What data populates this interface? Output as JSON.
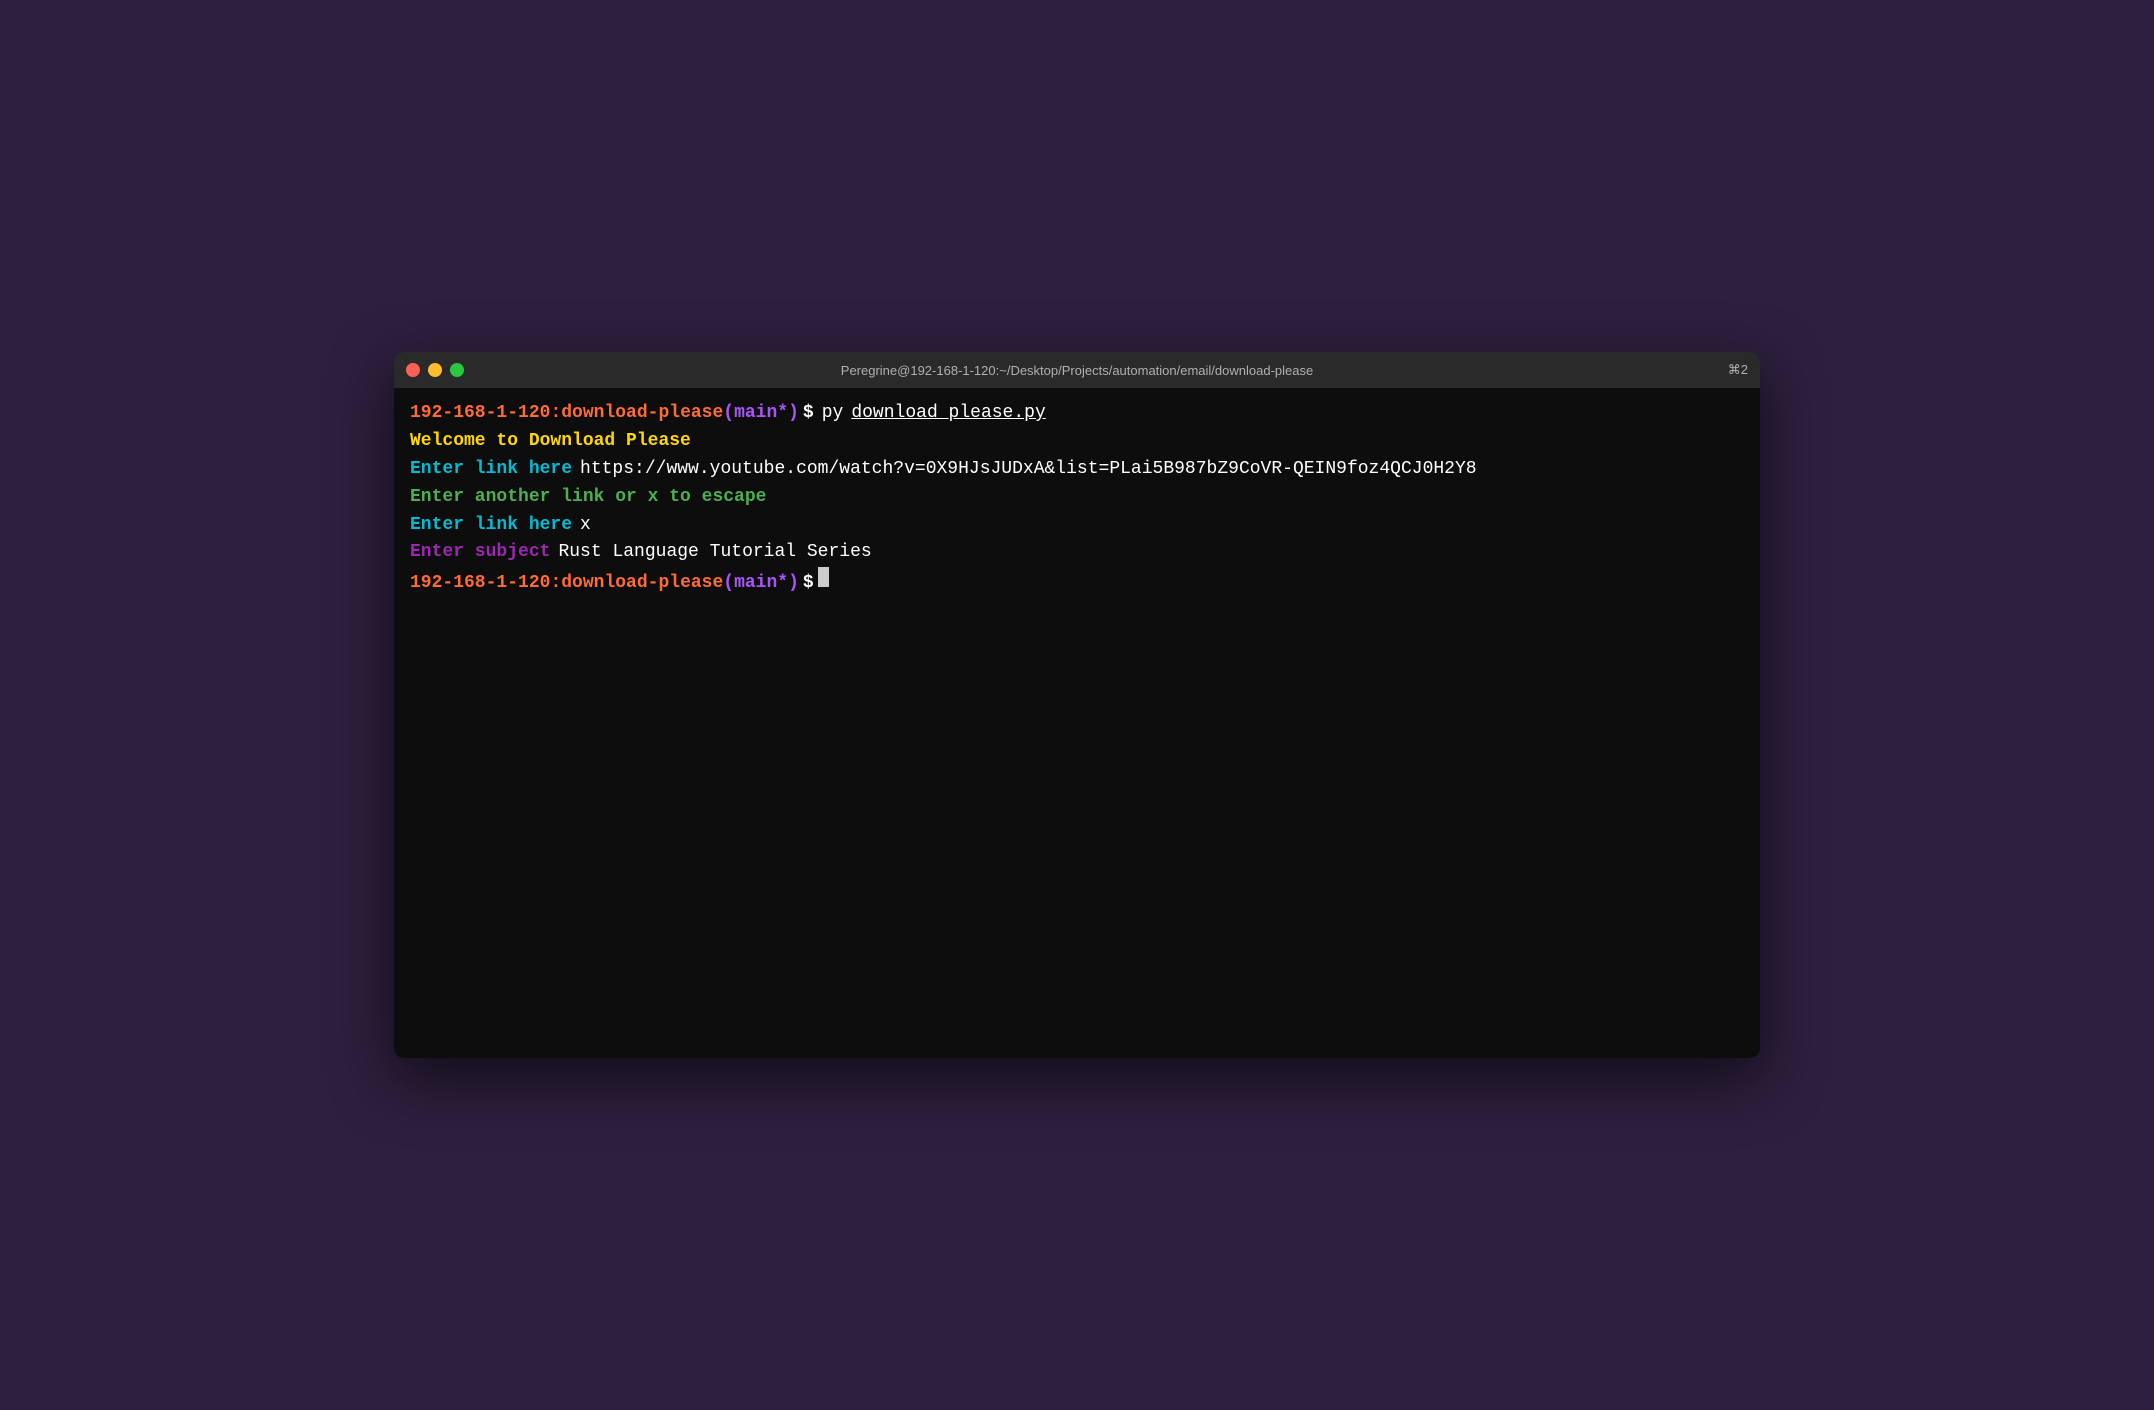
{
  "titleBar": {
    "title": "Peregrine@192-168-1-120:~/Desktop/Projects/automation/email/download-please",
    "shortcut": "⌘2"
  },
  "trafficLights": {
    "close": "close",
    "minimize": "minimize",
    "maximize": "maximize"
  },
  "lines": {
    "line1_prompt_host": "192-168-1-120",
    "line1_prompt_sep": ":",
    "line1_prompt_dir": "download-please",
    "line1_prompt_branch": " (main*)",
    "line1_prompt_dollar": " $",
    "line1_cmd": " py",
    "line1_file": " download_please.py",
    "line2_welcome": "Welcome to Download Please",
    "line3_label": "Enter link here",
    "line3_value": " https://www.youtube.com/watch?v=0X9HJsJUDxA&list=PLai5B987bZ9CoVR-QEIN9foz4QCJ0H2Y8",
    "line4_label": "Enter another link or x to escape",
    "line5_label": "Enter link here",
    "line5_value": " x",
    "line6_label": "Enter subject",
    "line6_value": " Rust Language Tutorial Series",
    "line7_prompt_host": "192-168-1-120",
    "line7_prompt_sep": ":",
    "line7_prompt_dir": "download-please",
    "line7_prompt_branch": " (main*)",
    "line7_prompt_dollar": " $"
  }
}
